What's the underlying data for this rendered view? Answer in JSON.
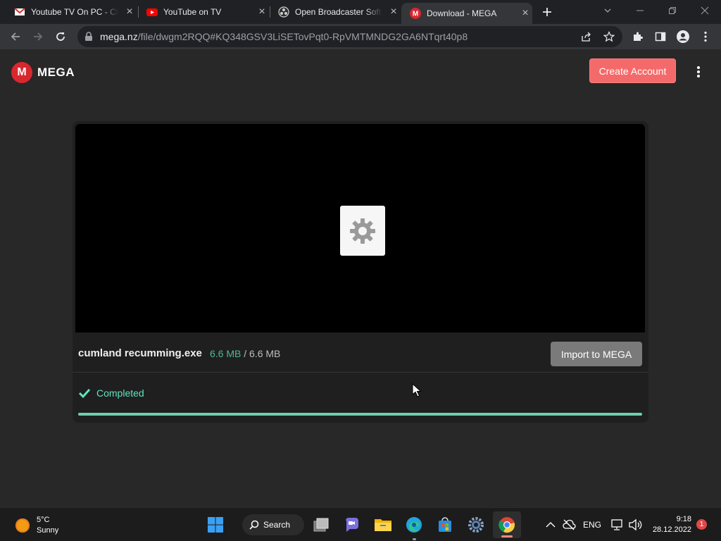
{
  "browser": {
    "tabs": [
      {
        "title": "Youtube TV On PC - Ch",
        "favicon": "gmail-icon",
        "active": false
      },
      {
        "title": "YouTube on TV",
        "favicon": "youtube-icon",
        "active": false
      },
      {
        "title": "Open Broadcaster Soft",
        "favicon": "obs-icon",
        "active": false
      },
      {
        "title": "Download - MEGA",
        "favicon": "mega-icon",
        "active": true
      }
    ],
    "new_tab_icon": "plus-icon",
    "url_host": "mega.nz",
    "url_path": "/file/dwgm2RQQ#KQ348GSV3LiSETovPqt0-RpVMTMNDG2GA6NTqrt40p8"
  },
  "header": {
    "logo_letter": "M",
    "logo_text": "MEGA",
    "create_account_label": "Create Account"
  },
  "file": {
    "name": "cumland recumming.exe",
    "downloaded": "6.6 MB",
    "separator": "/",
    "total": "6.6 MB",
    "import_label": "Import to MEGA",
    "status": "Completed",
    "progress_fraction": 1.0
  },
  "taskbar": {
    "weather_temp": "5°C",
    "weather_text": "Sunny",
    "search_label": "Search",
    "language": "ENG",
    "time": "9:18",
    "date": "28.12.2022",
    "notification_count": "1"
  },
  "colors": {
    "mega_red": "#d9272e",
    "create_account_bg": "#f46a6a",
    "progress_fill": "#6fcfae",
    "completed_text": "#5fe4bf"
  }
}
